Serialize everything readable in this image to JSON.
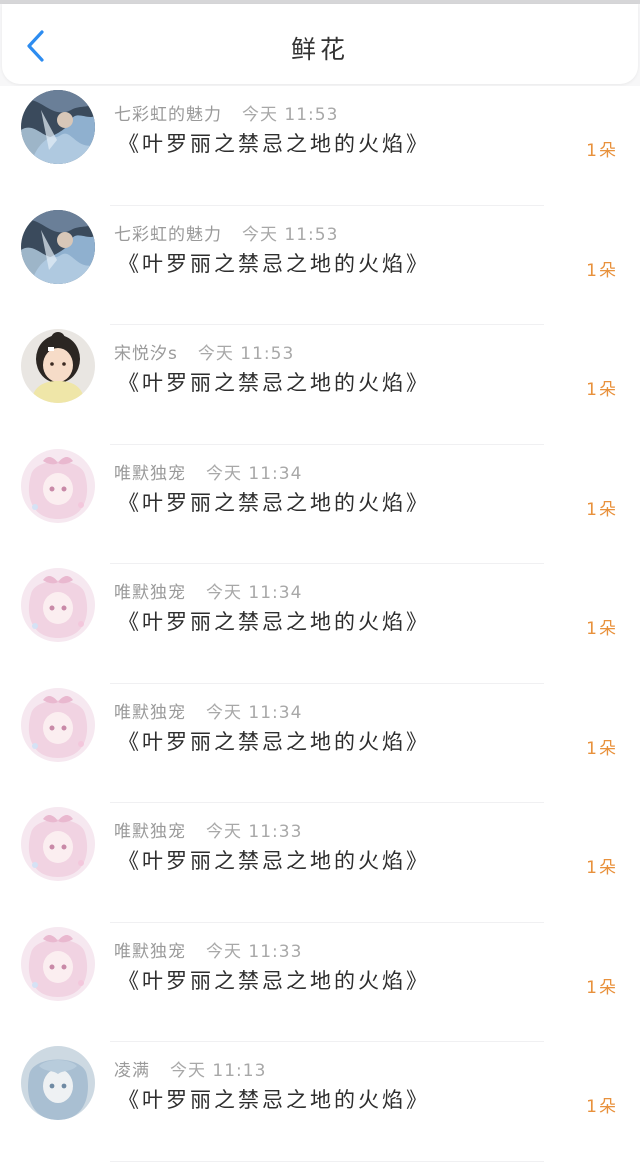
{
  "header": {
    "title": "鲜花",
    "back_icon": "chevron-left-icon",
    "accent_color": "#2d8cf0"
  },
  "records": [
    {
      "user": "七彩虹的魅力",
      "time": "今天 11:53",
      "gift": "《叶罗丽之禁忌之地的火焰》",
      "count": "1朵",
      "avatar": "art-avatar"
    },
    {
      "user": "七彩虹的魅力",
      "time": "今天 11:53",
      "gift": "《叶罗丽之禁忌之地的火焰》",
      "count": "1朵",
      "avatar": "art-avatar"
    },
    {
      "user": "宋悦汐s",
      "time": "今天 11:53",
      "gift": "《叶罗丽之禁忌之地的火焰》",
      "count": "1朵",
      "avatar": "girl-photo-avatar"
    },
    {
      "user": "唯默独宠",
      "time": "今天 11:34",
      "gift": "《叶罗丽之禁忌之地的火焰》",
      "count": "1朵",
      "avatar": "pink-anime-avatar"
    },
    {
      "user": "唯默独宠",
      "time": "今天 11:34",
      "gift": "《叶罗丽之禁忌之地的火焰》",
      "count": "1朵",
      "avatar": "pink-anime-avatar"
    },
    {
      "user": "唯默独宠",
      "time": "今天 11:34",
      "gift": "《叶罗丽之禁忌之地的火焰》",
      "count": "1朵",
      "avatar": "pink-anime-avatar"
    },
    {
      "user": "唯默独宠",
      "time": "今天 11:33",
      "gift": "《叶罗丽之禁忌之地的火焰》",
      "count": "1朵",
      "avatar": "pink-anime-avatar"
    },
    {
      "user": "唯默独宠",
      "time": "今天 11:33",
      "gift": "《叶罗丽之禁忌之地的火焰》",
      "count": "1朵",
      "avatar": "pink-anime-avatar"
    },
    {
      "user": "凌满",
      "time": "今天 11:13",
      "gift": "《叶罗丽之禁忌之地的火焰》",
      "count": "1朵",
      "avatar": "blue-anime-avatar"
    }
  ],
  "colors": {
    "count": "#e8913c",
    "name": "#9a9a9a",
    "gift": "#2e2e2e"
  }
}
